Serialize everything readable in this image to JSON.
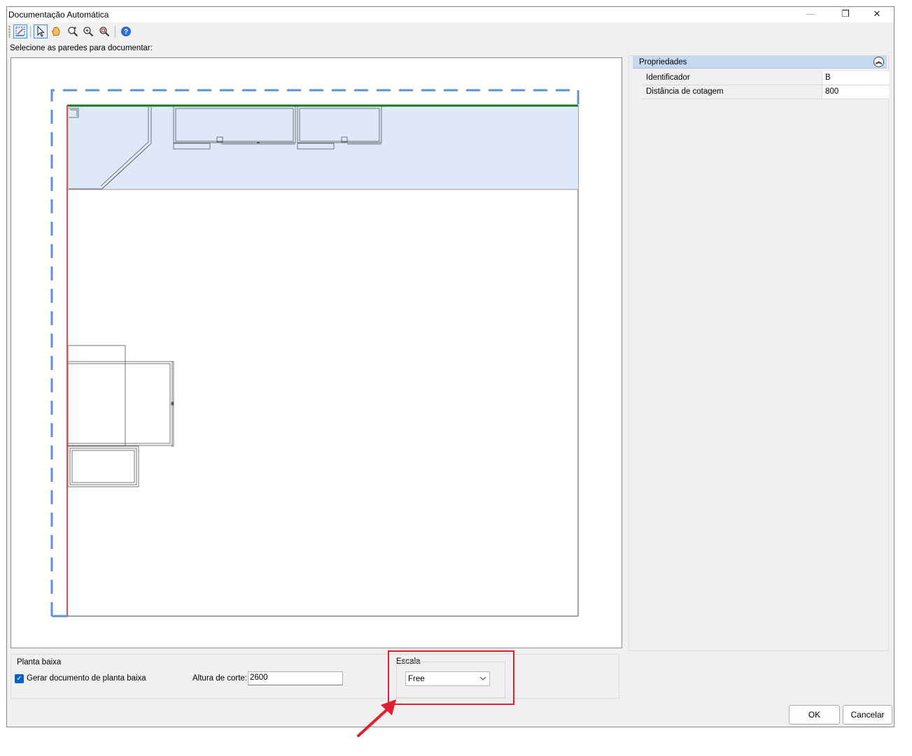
{
  "window": {
    "title": "Documentação Automática",
    "controls": {
      "minimize": "—",
      "maximize": "❐",
      "close": "✕"
    }
  },
  "toolbar": {
    "items": [
      "auto-document-icon",
      "select-pointer-icon",
      "pan-hand-icon",
      "zoom-window-icon",
      "zoom-in-icon",
      "zoom-extents-icon",
      "help-icon"
    ]
  },
  "canvas": {
    "prompt": "Selecione as paredes para documentar:",
    "colors": {
      "selection_dash": "#5b8fe0",
      "selected_wall": "#1a7a1a",
      "other_wall": "#d95555",
      "highlight_fill": "#dfe8f8"
    }
  },
  "properties": {
    "title": "Propriedades",
    "rows": [
      {
        "name": "Identificador",
        "value": "B"
      },
      {
        "name": "Distância de cotagem",
        "value": "800"
      }
    ]
  },
  "planta_baixa": {
    "group_label": "Planta baixa",
    "checkbox_label": "Gerar documento de planta baixa",
    "checked": true,
    "cut_height_label": "Altura de corte:",
    "cut_height_value": "2600"
  },
  "escala": {
    "group_label": "Escala",
    "selected": "Free"
  },
  "buttons": {
    "ok": "OK",
    "cancel": "Cancelar"
  },
  "annotation_color": "#e0202e"
}
